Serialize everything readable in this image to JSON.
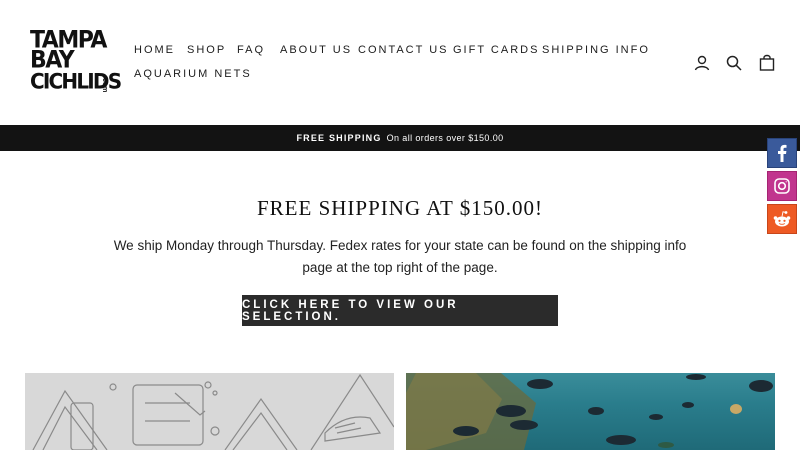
{
  "brand": {
    "logo_lines": [
      "TAMPA",
      "BAY",
      "CICHLIDS"
    ],
    "logo_suffix": ".com"
  },
  "nav": {
    "items": [
      {
        "label": "HOME"
      },
      {
        "label": "SHOP"
      },
      {
        "label": "FAQ"
      },
      {
        "label": "ABOUT US"
      },
      {
        "label": "CONTACT US"
      },
      {
        "label": "GIFT CARDS"
      },
      {
        "label": "SHIPPING INFO"
      },
      {
        "label": "AQUARIUM NETS"
      }
    ]
  },
  "header_icons": [
    "user-icon",
    "search-icon",
    "cart-icon"
  ],
  "announcement": {
    "strong": "FREE SHIPPING",
    "light": "On all orders over $150.00"
  },
  "social": [
    "facebook-icon",
    "instagram-icon",
    "reddit-icon"
  ],
  "hero": {
    "title": "FREE SHIPPING AT $150.00!",
    "body": "We ship Monday through Thursday. Fedex rates for your state can be found on the shipping info page at the top right of the page.",
    "cta": "CLICK HERE TO VIEW OUR SELECTION."
  },
  "colors": {
    "announcement_bg": "#131313",
    "cta_bg": "#2b2b2b",
    "facebook": "#3a5a9b",
    "instagram": "#c1358e",
    "reddit": "#ee5a24"
  }
}
